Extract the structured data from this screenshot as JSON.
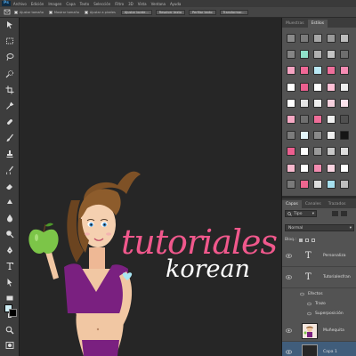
{
  "app": {
    "logo": "Ps"
  },
  "menu": [
    "Archivo",
    "Edición",
    "Imagen",
    "Capa",
    "Texto",
    "Selección",
    "Filtro",
    "3D",
    "Vista",
    "Ventana",
    "Ayuda"
  ],
  "options": {
    "checkboxes": [
      "Ajustar tamaño",
      "Mostrar tamaño",
      "Ajustar a píxeles"
    ],
    "buttons": [
      "Ajustar borde...",
      "Resolver texto",
      "Perfilar texto",
      "Transformar..."
    ]
  },
  "tools": [
    "move-icon",
    "marquee-icon",
    "lasso-icon",
    "quick-selection-icon",
    "crop-icon",
    "eyedropper-icon",
    "healing-brush-icon",
    "brush-icon",
    "clone-stamp-icon",
    "history-brush-icon",
    "eraser-icon",
    "gradient-icon",
    "blur-icon",
    "dodge-icon",
    "pen-icon",
    "type-icon",
    "path-selection-icon",
    "rectangle-icon",
    "hand-icon",
    "zoom-icon"
  ],
  "colors": {
    "foreground": "#cfeef5",
    "background": "#000000",
    "accent_pink": "#f0588c",
    "purple": "#7a2080"
  },
  "artwork": {
    "title": "tutoriales",
    "subtitle": "korean"
  },
  "top_panel": {
    "tabs": [
      "Muestras",
      "Estilos"
    ],
    "active": "Estilos"
  },
  "styles_grid": [
    [
      "#8a8a8a",
      "#7b7b7b",
      "#a8a8a8",
      "#999999",
      "#bdbdbd"
    ],
    [
      "#858585",
      "#8fe1c9",
      "#b0b0b0",
      "#c4c4c4",
      "#6e6e6e"
    ],
    [
      "#f4a3c1",
      "#f06896",
      "#b9e8f4",
      "#ee6f9b",
      "#f58cb3"
    ],
    [
      "#ffffff",
      "#ec5f8f",
      "#ffffff",
      "#ffc0d6",
      "#eeeeee"
    ],
    [
      "#fefefe",
      "#e5e5e5",
      "#efefef",
      "#f5d0dd",
      "#fbe3ec"
    ],
    [
      "#f5a8c3",
      "#6f6f6f",
      "#ef6e99",
      "#f0f0f0",
      "#505050"
    ],
    [
      "#7c7c7c",
      "#e3f6fb",
      "#8a8a8a",
      "#f0f0f0",
      "#151515"
    ],
    [
      "#ec5f8f",
      "#ffffff",
      "#9a9a9a",
      "#c8c8c8",
      "#dedede"
    ],
    [
      "#f6b8cd",
      "#ffffff",
      "#f38cb0",
      "#f9d4e1",
      "#ffffff"
    ],
    [
      "#7a7a7a",
      "#ee668f",
      "#dedede",
      "#a6e0ef",
      "#c0c0c0"
    ]
  ],
  "layers_panel": {
    "tabs": [
      "Capas",
      "Canales",
      "Trazados"
    ],
    "active": "Capas",
    "filter": "Tipo",
    "blend_mode": "Normal",
    "lock_label": "Bloq.:",
    "layers": [
      {
        "name": "Personaliza",
        "kind": "text"
      },
      {
        "name": "Tutorialesfran",
        "kind": "text"
      },
      {
        "name": "Muñequita",
        "kind": "image"
      },
      {
        "name": "Capa 1",
        "kind": "image"
      }
    ],
    "effects": {
      "label": "Efectos",
      "items": [
        "Trazo",
        "Superposición"
      ]
    }
  }
}
